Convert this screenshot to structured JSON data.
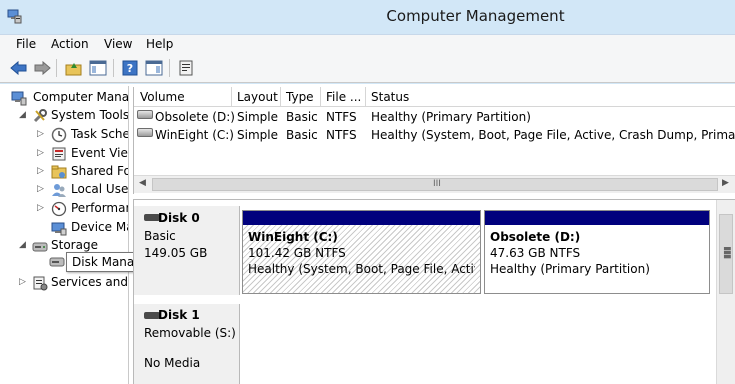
{
  "window": {
    "title": "Computer Management",
    "icon": "computer-management-icon"
  },
  "menu": [
    {
      "label": "File"
    },
    {
      "label": "Action"
    },
    {
      "label": "View"
    },
    {
      "label": "Help"
    }
  ],
  "toolbar": {
    "buttons": [
      "back-arrow-icon",
      "forward-arrow-icon",
      "up-folder-icon",
      "show-hide-tree-icon",
      "help-icon",
      "show-hide-action-pane-icon",
      "properties-icon"
    ]
  },
  "tree": {
    "items": [
      {
        "label": "Computer Manag",
        "icon": "computer-icon",
        "expander": ""
      },
      {
        "label": "System Tools",
        "icon": "system-tools-icon",
        "expander": "◢"
      },
      {
        "label": "Task Sche",
        "icon": "clock-icon",
        "expander": "▷"
      },
      {
        "label": "Event View",
        "icon": "event-viewer-icon",
        "expander": "▷"
      },
      {
        "label": "Shared Fo",
        "icon": "shared-folder-icon",
        "expander": "▷"
      },
      {
        "label": "Local User",
        "icon": "users-icon",
        "expander": "▷"
      },
      {
        "label": "Performar",
        "icon": "performance-icon",
        "expander": "▷"
      },
      {
        "label": "Device Ma",
        "icon": "device-manager-icon",
        "expander": ""
      },
      {
        "label": "Storage",
        "icon": "storage-icon",
        "expander": "◢"
      },
      {
        "label": "Services and A",
        "icon": "services-icon",
        "expander": "▷"
      }
    ],
    "tooltip": "Disk Management"
  },
  "volumes": {
    "columns": [
      "Volume",
      "Layout",
      "Type",
      "File ...",
      "Status"
    ],
    "rows": [
      {
        "volume": "Obsolete (D:)",
        "layout": "Simple",
        "type": "Basic",
        "fs": "NTFS",
        "status": "Healthy (Primary Partition)"
      },
      {
        "volume": "WinEight (C:)",
        "layout": "Simple",
        "type": "Basic",
        "fs": "NTFS",
        "status": "Healthy (System, Boot, Page File, Active, Crash Dump, Primary Par"
      }
    ],
    "scroll_grip": "III"
  },
  "disks": [
    {
      "name": "Disk 0",
      "kind": "Basic",
      "size": "149.05 GB",
      "partitions": [
        {
          "name": "WinEight  (C:)",
          "size": "101.42 GB NTFS",
          "status": "Healthy (System, Boot, Page File, Active, C"
        },
        {
          "name": "Obsolete  (D:)",
          "size": "47.63 GB NTFS",
          "status": "Healthy (Primary Partition)"
        }
      ]
    },
    {
      "name": "Disk 1",
      "kind": "Removable (S:)",
      "media": "No Media"
    }
  ],
  "colors": {
    "partition_bar": "#00007d",
    "titlebar": "#d2e7f7"
  }
}
